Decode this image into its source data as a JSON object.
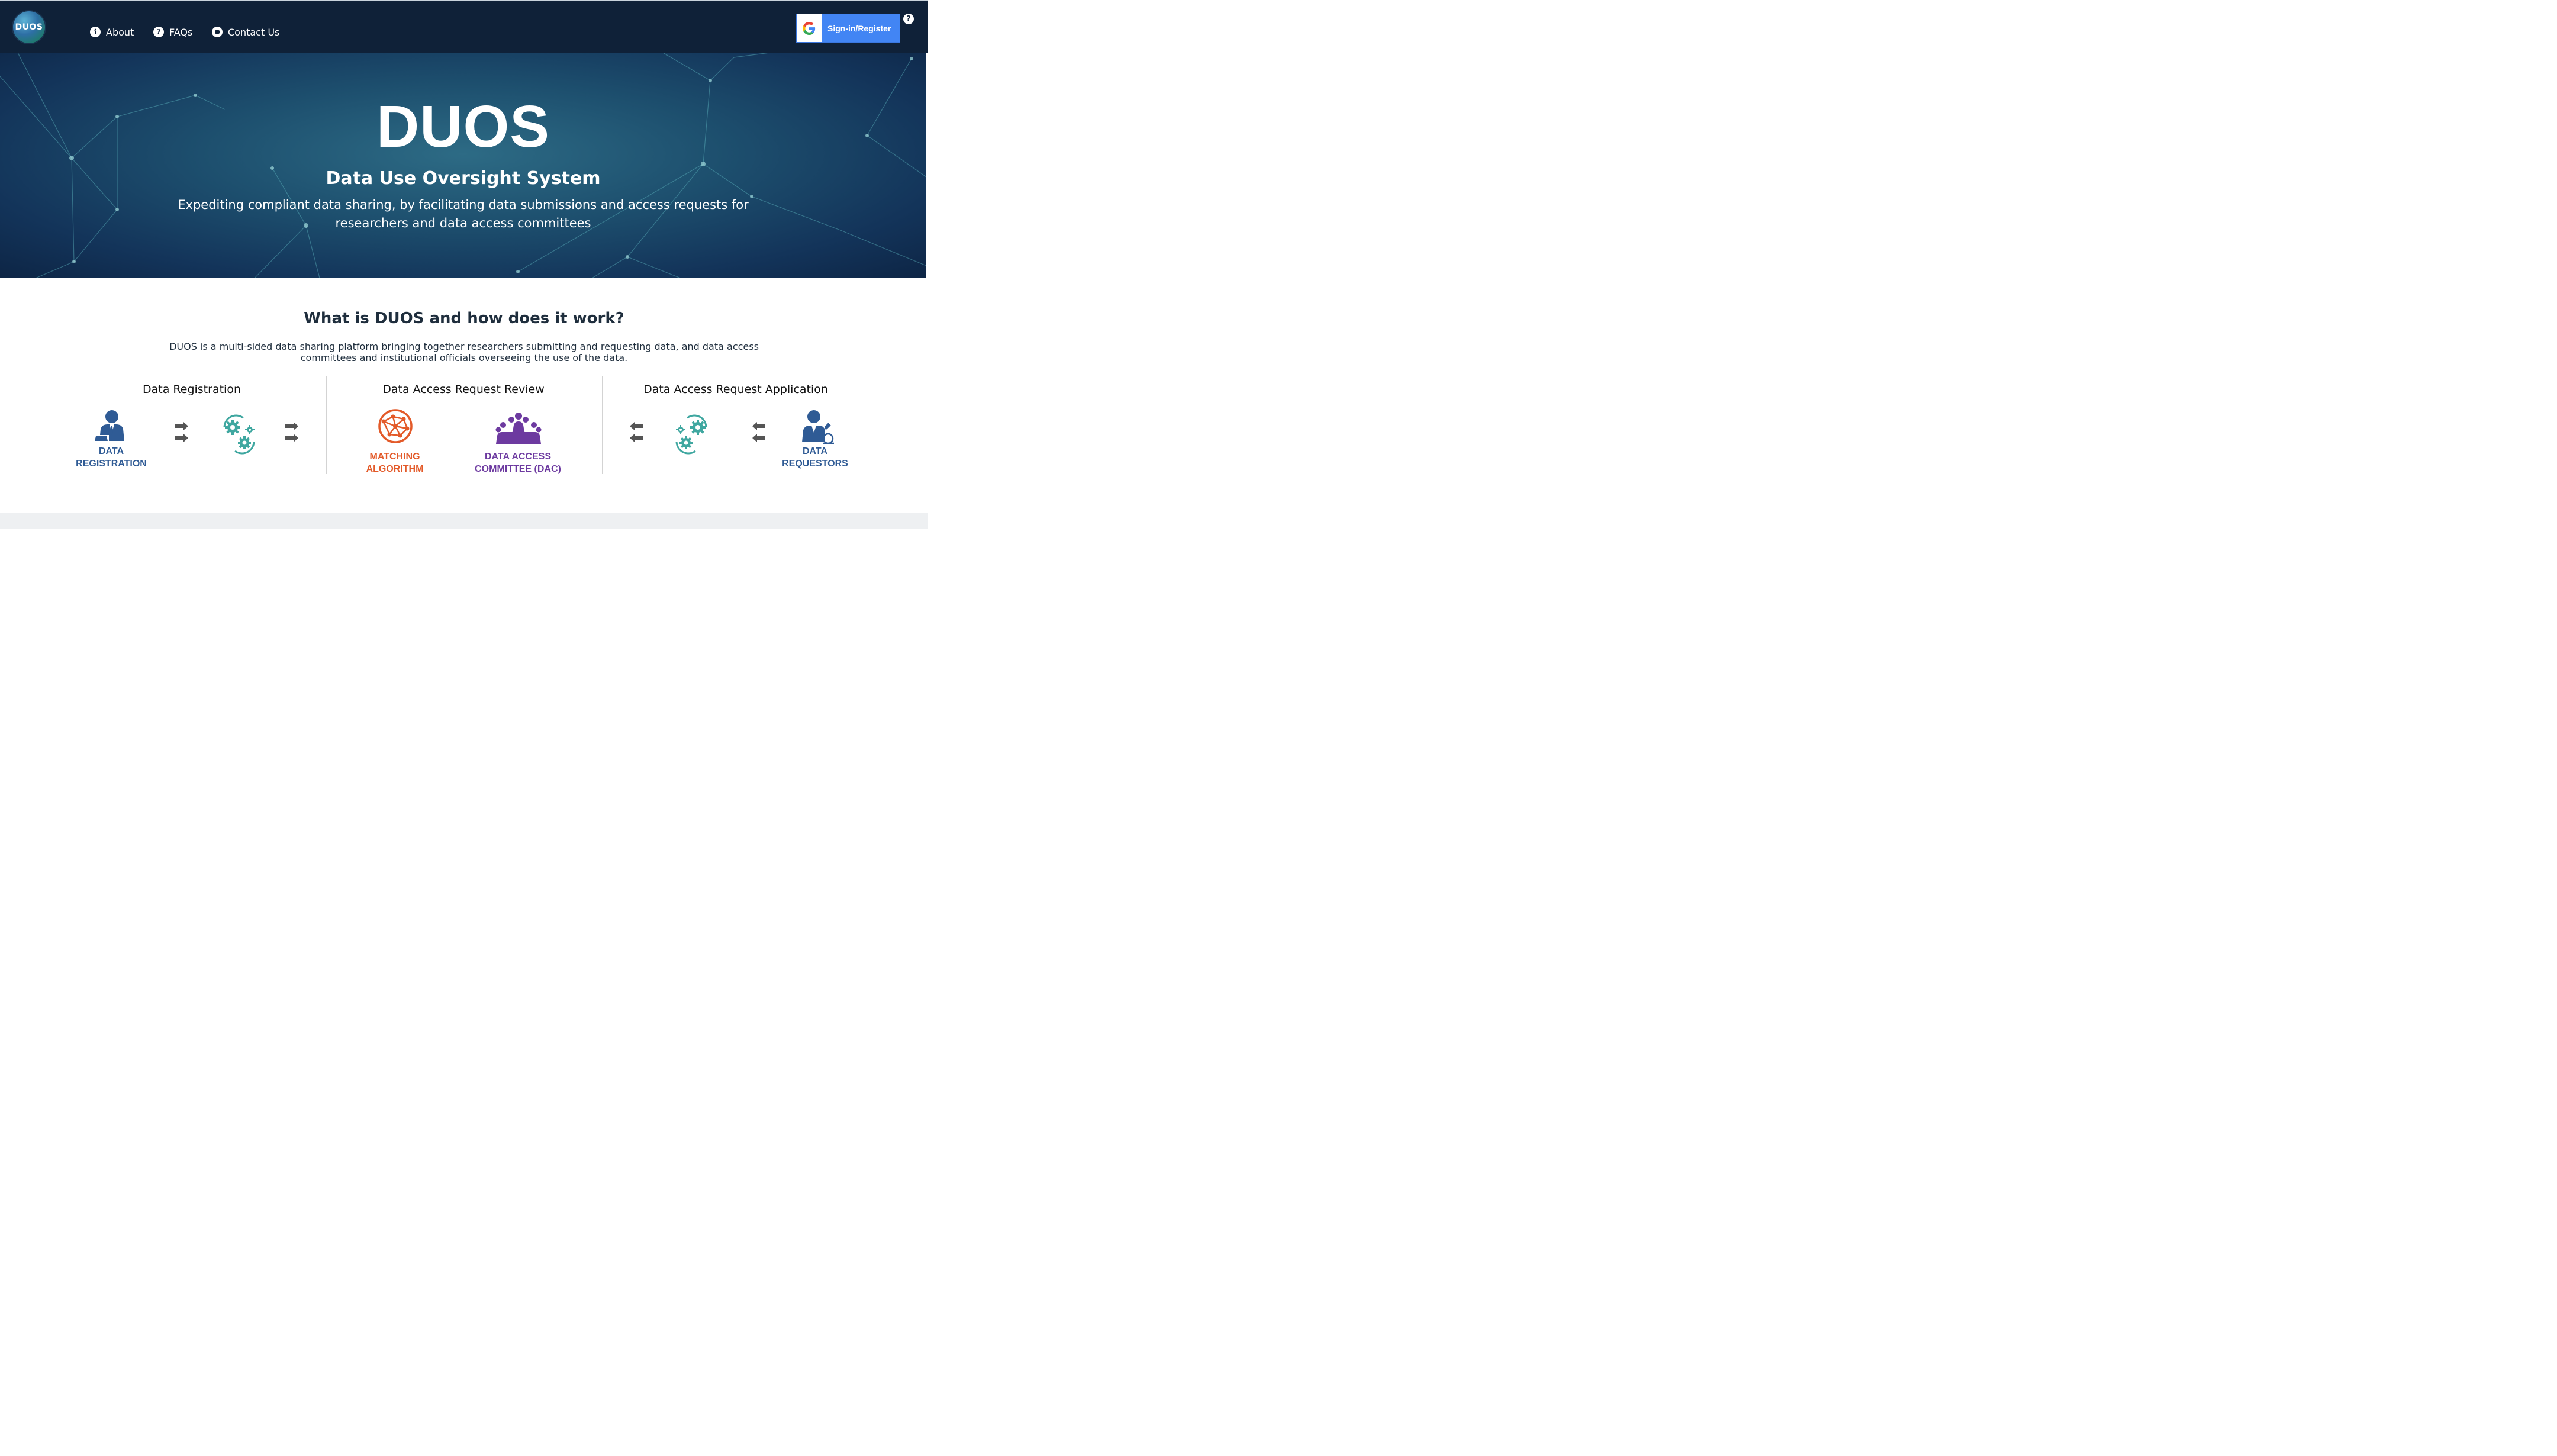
{
  "nav": {
    "logo_text": "DUOS",
    "items": [
      {
        "label": "About",
        "icon": "info-icon"
      },
      {
        "label": "FAQs",
        "icon": "question-icon"
      },
      {
        "label": "Contact Us",
        "icon": "chat-icon"
      }
    ],
    "signin_label": "Sign-in/Register",
    "help_icon": "question-icon"
  },
  "hero": {
    "title": "DUOS",
    "subtitle": "Data Use Oversight System",
    "description": "Expediting compliant data sharing, by facilitating data submissions and access requests for researchers and data access committees"
  },
  "section": {
    "title": "What is DUOS and how does it work?",
    "description": "DUOS is a multi-sided data sharing platform bringing together researchers submitting and requesting data, and data access committees and institutional officials overseeing the use of the data."
  },
  "columns": [
    {
      "title": "Data Registration"
    },
    {
      "title": "Data Access Request Review"
    },
    {
      "title": "Data Access Request Application"
    }
  ],
  "captions": {
    "data_registration": [
      "DATA",
      "REGISTRATION"
    ],
    "matching_algorithm": [
      "MATCHING",
      "ALGORITHM"
    ],
    "dac": [
      "DATA ACCESS",
      "COMMITTEE (DAC)"
    ],
    "data_requestors": [
      "DATA",
      "REQUESTORS"
    ]
  },
  "colors": {
    "navbar": "#0f2138",
    "google_blue": "#4285f4",
    "teal": "#3fa7a0",
    "blue": "#2f5b95",
    "orange": "#e35a29",
    "purple": "#6d3aa0"
  }
}
